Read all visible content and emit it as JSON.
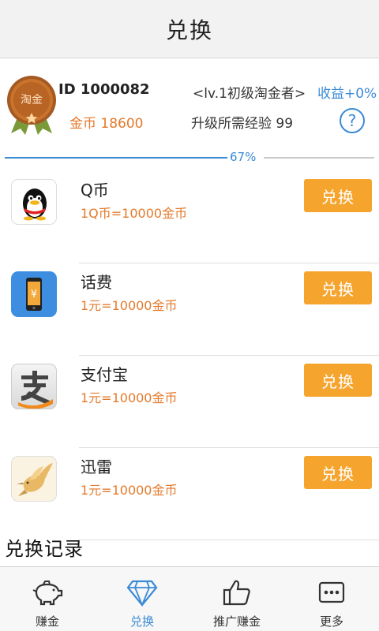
{
  "header": {
    "title": "兑换"
  },
  "profile": {
    "medal_text": "淘金",
    "id_label": "ID 1000082",
    "level": "<lv.1初级淘金者>",
    "income": "收益+0%",
    "coins": "金币 18600",
    "exp_needed": "升级所需经验 99",
    "help_glyph": "?",
    "progress_percent": 67,
    "progress_label": "67%"
  },
  "exchange_items": [
    {
      "name": "Q币",
      "rate": "1Q币=10000金币",
      "button": "兑换",
      "icon": "qq-penguin-icon"
    },
    {
      "name": "话费",
      "rate": "1元=10000金币",
      "button": "兑换",
      "icon": "phone-bill-icon"
    },
    {
      "name": "支付宝",
      "rate": "1元=10000金币",
      "button": "兑换",
      "icon": "alipay-icon"
    },
    {
      "name": "迅雷",
      "rate": "1元=10000金币",
      "button": "兑换",
      "icon": "xunlei-bird-icon"
    }
  ],
  "records_title": "兑换记录",
  "tabbar": {
    "active": 1,
    "tabs": [
      {
        "label": "赚金",
        "icon": "piggy-bank-icon"
      },
      {
        "label": "兑换",
        "icon": "diamond-icon"
      },
      {
        "label": "推广赚金",
        "icon": "thumbs-up-icon"
      },
      {
        "label": "更多",
        "icon": "more-dots-icon"
      }
    ]
  },
  "colors": {
    "accent_blue": "#3b8ad6",
    "accent_orange": "#e47a2c",
    "button_orange": "#f5a42e"
  }
}
